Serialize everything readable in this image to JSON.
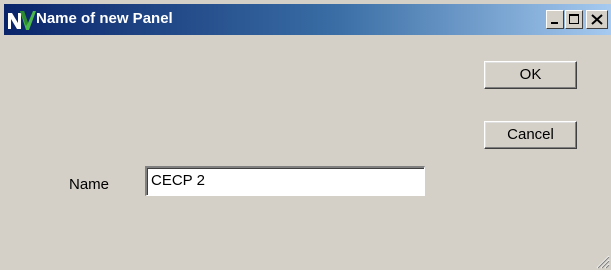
{
  "window": {
    "title": "Name of new Panel",
    "app_icon": "nv-logo-icon",
    "controls": {
      "minimize": "minimize-icon",
      "maximize": "maximize-icon",
      "close": "close-icon"
    },
    "colors": {
      "titlebar_start": "#0a246a",
      "titlebar_end": "#a6caf0",
      "face": "#d4d0c8"
    }
  },
  "buttons": {
    "ok_label": "OK",
    "cancel_label": "Cancel"
  },
  "form": {
    "name_label": "Name",
    "name_value": "CECP 2"
  }
}
